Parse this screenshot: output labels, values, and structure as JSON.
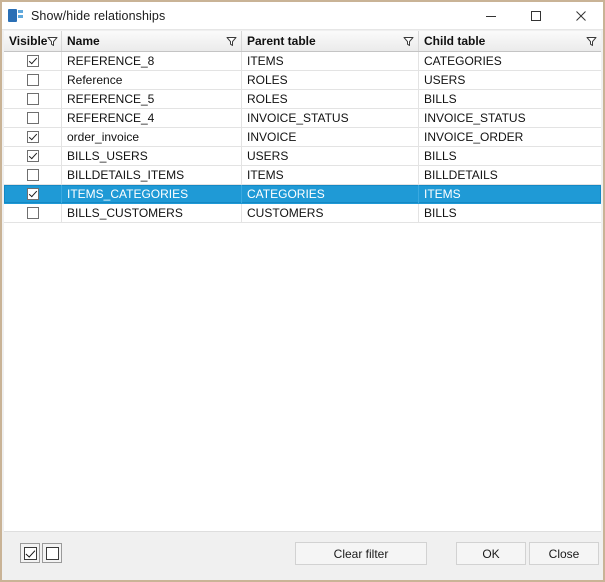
{
  "window": {
    "title": "Show/hide relationships",
    "icon": "relationships-icon",
    "controls": {
      "minimize": "minimize-icon",
      "maximize": "maximize-icon",
      "close": "close-icon"
    }
  },
  "grid": {
    "columns": [
      {
        "label": "Visible",
        "filter_icon": "filter-icon"
      },
      {
        "label": "Name",
        "filter_icon": "filter-icon"
      },
      {
        "label": "Parent table",
        "filter_icon": "filter-icon"
      },
      {
        "label": "Child table",
        "filter_icon": "filter-icon"
      }
    ],
    "rows": [
      {
        "visible": true,
        "name": "REFERENCE_8",
        "parent": "ITEMS",
        "child": "CATEGORIES",
        "selected": false
      },
      {
        "visible": false,
        "name": "Reference",
        "parent": "ROLES",
        "child": "USERS",
        "selected": false
      },
      {
        "visible": false,
        "name": "REFERENCE_5",
        "parent": "ROLES",
        "child": "BILLS",
        "selected": false
      },
      {
        "visible": false,
        "name": "REFERENCE_4",
        "parent": "INVOICE_STATUS",
        "child": "INVOICE_STATUS",
        "selected": false
      },
      {
        "visible": true,
        "name": "order_invoice",
        "parent": "INVOICE",
        "child": "INVOICE_ORDER",
        "selected": false
      },
      {
        "visible": true,
        "name": "BILLS_USERS",
        "parent": "USERS",
        "child": "BILLS",
        "selected": false
      },
      {
        "visible": false,
        "name": "BILLDETAILS_ITEMS",
        "parent": "ITEMS",
        "child": "BILLDETAILS",
        "selected": false
      },
      {
        "visible": true,
        "name": "ITEMS_CATEGORIES",
        "parent": "CATEGORIES",
        "child": "ITEMS",
        "selected": true
      },
      {
        "visible": false,
        "name": "BILLS_CUSTOMERS",
        "parent": "CUSTOMERS",
        "child": "BILLS",
        "selected": false
      }
    ]
  },
  "footer": {
    "check_all": {
      "name": "check-all-toggle",
      "checked": true
    },
    "uncheck_all": {
      "name": "uncheck-all-toggle",
      "checked": false
    },
    "clear_filter_label": "Clear filter",
    "ok_label": "OK",
    "close_label": "Close"
  },
  "colors": {
    "selection": "#1f9ad6",
    "window_border": "#c9b396",
    "header_bg": "#f3f3f3",
    "footer_bg": "#f0f0f0"
  }
}
